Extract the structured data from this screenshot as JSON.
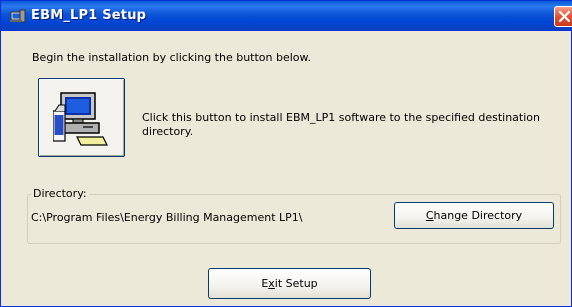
{
  "window": {
    "title": "EBM_LP1 Setup",
    "titlebar_color": "#0054e3",
    "background_color": "#ece9d8"
  },
  "intro_text": "Begin the installation by clicking the button below.",
  "install": {
    "icon": "computer-install-icon",
    "description": "Click this button to install EBM_LP1 software to the specified destination directory."
  },
  "directory": {
    "group_label": "Directory:",
    "path": "C:\\Program Files\\Energy Billing Management LP1\\"
  },
  "buttons": {
    "change_directory": {
      "mnemonic": "C",
      "rest": "hange Directory"
    },
    "exit_setup": {
      "pre": "E",
      "mnemonic": "x",
      "post": "it Setup"
    }
  }
}
